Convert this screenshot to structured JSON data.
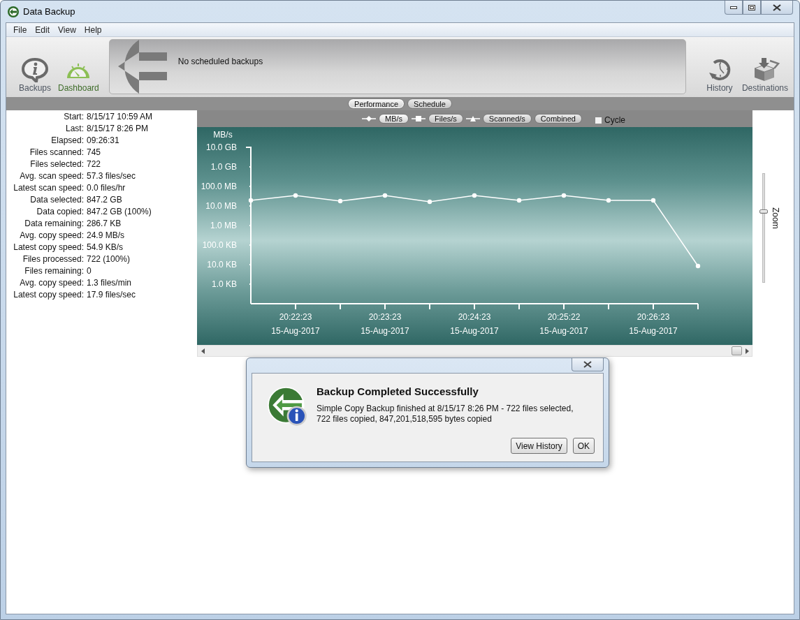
{
  "window": {
    "title": "Data Backup"
  },
  "menu": [
    "File",
    "Edit",
    "View",
    "Help"
  ],
  "toolbar": {
    "left": [
      {
        "label": "Backups",
        "kind": "backups",
        "selected": false
      },
      {
        "label": "Dashboard",
        "kind": "dashboard",
        "selected": true
      }
    ],
    "banner": "No scheduled backups",
    "right": [
      {
        "label": "History",
        "kind": "history",
        "selected": false
      },
      {
        "label": "Destinations",
        "kind": "destinations",
        "selected": false
      }
    ]
  },
  "tabs": [
    {
      "label": "Performance",
      "selected": true
    },
    {
      "label": "Schedule",
      "selected": false
    }
  ],
  "stats": [
    {
      "label": "Start:",
      "value": "8/15/17 10:59 AM"
    },
    {
      "label": "Last:",
      "value": "8/15/17 8:26 PM"
    },
    {
      "label": "Elapsed:",
      "value": "09:26:31"
    },
    {
      "label": "Files scanned:",
      "value": "745"
    },
    {
      "label": "Files selected:",
      "value": "722"
    },
    {
      "label": "Avg. scan speed:",
      "value": "57.3 files/sec"
    },
    {
      "label": "Latest scan speed:",
      "value": "0.0 files/hr"
    },
    {
      "label": "Data selected:",
      "value": "847.2 GB"
    },
    {
      "label": "Data copied:",
      "value": "847.2 GB (100%)"
    },
    {
      "label": "Data remaining:",
      "value": "286.7 KB"
    },
    {
      "label": "Avg. copy speed:",
      "value": "24.9 MB/s"
    },
    {
      "label": "Latest copy speed:",
      "value": "54.9 KB/s"
    },
    {
      "label": "Files processed:",
      "value": "722 (100%)"
    },
    {
      "label": "Files remaining:",
      "value": "0"
    },
    {
      "label": "Avg. copy speed:",
      "value": "1.3 files/min"
    },
    {
      "label": "Latest copy speed:",
      "value": "17.9 files/sec"
    }
  ],
  "chart_controls": {
    "series_buttons": [
      {
        "label": "MB/s",
        "kind": "diamond",
        "selected": true
      },
      {
        "label": "Files/s",
        "kind": "square",
        "selected": false
      },
      {
        "label": "Scanned/s",
        "kind": "triangle",
        "selected": false
      },
      {
        "label": "Combined",
        "kind": "none",
        "selected": false
      }
    ],
    "cycle": {
      "label": "Cycle",
      "checked": false
    }
  },
  "chart": {
    "axis_title": "MB/s",
    "y_labels": [
      "10.0 GB",
      "1.0 GB",
      "100.0 MB",
      "10.0 MB",
      "1.0 MB",
      "100.0 KB",
      "10.0 KB",
      "1.0 KB"
    ],
    "x_labels": [
      "20:22:23\n15-Aug-2017",
      "20:23:23\n15-Aug-2017",
      "20:24:23\n15-Aug-2017",
      "20:25:22\n15-Aug-2017",
      "20:26:23\n15-Aug-2017"
    ]
  },
  "zoom": {
    "label": "Zoom",
    "level": 0.66
  },
  "dialog": {
    "title": "Backup Completed Successfully",
    "message": "Simple Copy Backup finished at 8/15/17 8:26 PM - 722 files selected, 722 files copied, 847,201,518,595 bytes copied",
    "buttons": [
      "View History",
      "OK"
    ]
  }
}
